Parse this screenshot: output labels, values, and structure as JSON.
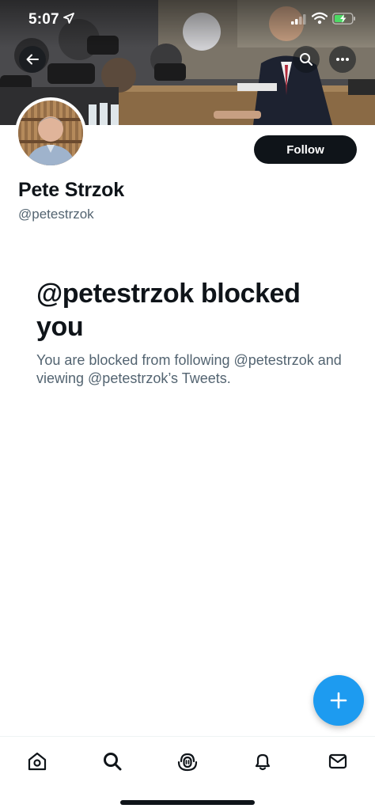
{
  "status_bar": {
    "time": "5:07"
  },
  "profile": {
    "display_name": "Pete Strzok",
    "handle": "@petestrzok",
    "follow_label": "Follow"
  },
  "blocked_notice": {
    "title": "@petestrzok blocked you",
    "description": "You are blocked from following @petestrzok and viewing @petestrzok’s Tweets."
  },
  "icons": {
    "back": "arrow-left-icon",
    "search": "search-icon",
    "more": "more-horizontal-icon",
    "compose": "plus-icon",
    "tabs": [
      "home-icon",
      "search-icon",
      "spaces-icon",
      "notifications-icon",
      "messages-icon"
    ]
  },
  "colors": {
    "accent": "#1d9bf0",
    "text_primary": "#0f1419",
    "text_secondary": "#536471",
    "follow_bg": "#0f1419"
  }
}
